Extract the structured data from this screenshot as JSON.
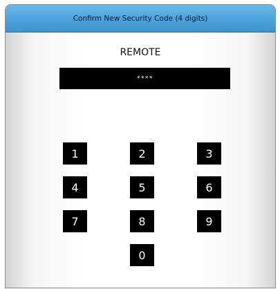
{
  "dialog": {
    "title": "Confirm New Security Code (4 digits)",
    "remote_label": "REMOTE",
    "code_value": "****"
  },
  "keypad": {
    "keys": [
      "1",
      "2",
      "3",
      "4",
      "5",
      "6",
      "7",
      "8",
      "9",
      "0"
    ]
  },
  "colors": {
    "title_bar": "#4aa3dd",
    "keypad_key": "#000000",
    "code_display": "#000000"
  }
}
